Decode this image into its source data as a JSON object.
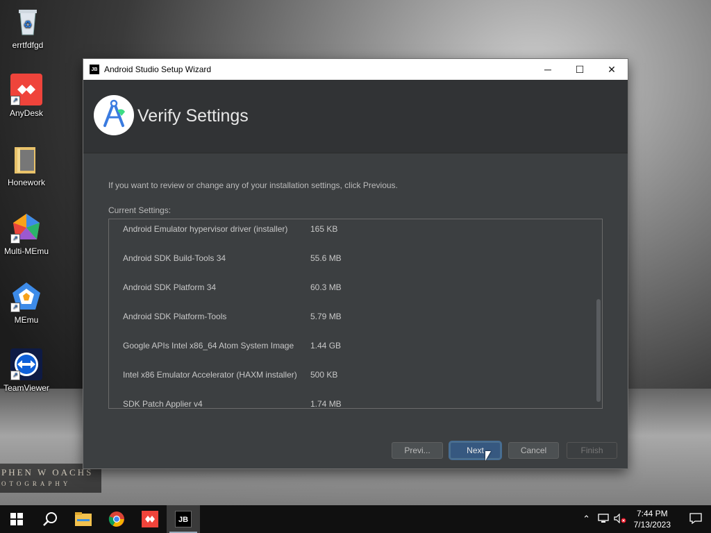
{
  "desktop": {
    "icons": [
      {
        "label": "errtfdfgd",
        "icon": "recycle-bin-icon"
      },
      {
        "label": "AnyDesk",
        "icon": "anydesk-icon"
      },
      {
        "label": "Honework",
        "icon": "folder-icon"
      },
      {
        "label": "Multi-MEmu",
        "icon": "multi-memu-icon"
      },
      {
        "label": "MEmu",
        "icon": "memu-icon"
      },
      {
        "label": "TeamViewer",
        "icon": "teamviewer-icon"
      }
    ],
    "watermark_line1": "PHEN W OACHS",
    "watermark_line2": "OTOGRAPHY"
  },
  "window": {
    "title": "Android Studio Setup Wizard",
    "controls": {
      "minimize": "─",
      "maximize": "☐",
      "close": "✕"
    },
    "heading": "Verify Settings",
    "intro": "If you want to review or change any of your installation settings, click Previous.",
    "current_settings_label": "Current Settings:",
    "settings": [
      {
        "name": "Android Emulator hypervisor driver (installer)",
        "size": "165 KB"
      },
      {
        "name": "Android SDK Build-Tools 34",
        "size": "55.6 MB"
      },
      {
        "name": "Android SDK Platform 34",
        "size": "60.3 MB"
      },
      {
        "name": "Android SDK Platform-Tools",
        "size": "5.79 MB"
      },
      {
        "name": "Google APIs Intel x86_64 Atom System Image",
        "size": "1.44 GB"
      },
      {
        "name": "Intel x86 Emulator Accelerator (HAXM installer)",
        "size": "500 KB"
      },
      {
        "name": "SDK Patch Applier v4",
        "size": "1.74 MB"
      }
    ],
    "buttons": {
      "previous": "Previ...",
      "next": "Next",
      "cancel": "Cancel",
      "finish": "Finish"
    }
  },
  "taskbar": {
    "items": [
      "start-icon",
      "search-icon",
      "file-explorer-icon",
      "chrome-icon",
      "anydesk-icon",
      "jetbrains-icon"
    ],
    "jb_label": "JB",
    "time": "7:44 PM",
    "date": "7/13/2023"
  },
  "colors": {
    "accent": "#365880",
    "window_bg": "#3c3f41",
    "header_bg": "#313335"
  }
}
